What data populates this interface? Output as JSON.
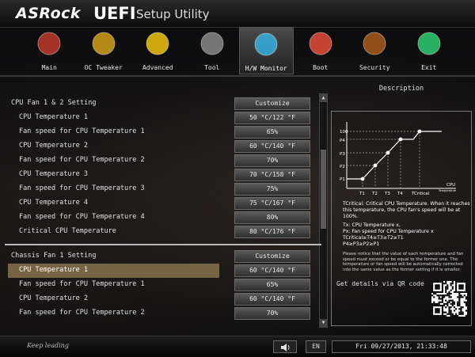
{
  "header": {
    "brand": "ASRock",
    "uefi": "UEFI",
    "subtitle": "Setup Utility"
  },
  "nav": [
    {
      "label": "Main",
      "icon": "main-icon"
    },
    {
      "label": "OC Tweaker",
      "icon": "rocket-icon"
    },
    {
      "label": "Advanced",
      "icon": "star-icon"
    },
    {
      "label": "Tool",
      "icon": "toolbox-icon"
    },
    {
      "label": "H/W Monitor",
      "icon": "radar-icon",
      "active": true
    },
    {
      "label": "Boot",
      "icon": "joystick-icon"
    },
    {
      "label": "Security",
      "icon": "shield-icon"
    },
    {
      "label": "Exit",
      "icon": "exit-icon"
    }
  ],
  "rows": [
    {
      "label": "CPU Fan 1 & 2 Setting",
      "value": "Customize",
      "section": true
    },
    {
      "label": "CPU Temperature 1",
      "value": "50 °C/122 °F"
    },
    {
      "label": "Fan speed for CPU Temperature 1",
      "value": "65%"
    },
    {
      "label": "CPU Temperature 2",
      "value": "60 °C/140 °F"
    },
    {
      "label": "Fan speed for CPU Temperature 2",
      "value": "70%"
    },
    {
      "label": "CPU Temperature 3",
      "value": "70 °C/158 °F"
    },
    {
      "label": "Fan speed for CPU Temperature 3",
      "value": "75%"
    },
    {
      "label": "CPU Temperature 4",
      "value": "75 °C/167 °F"
    },
    {
      "label": "Fan speed for CPU Temperature 4",
      "value": "80%"
    },
    {
      "label": "Critical CPU Temperature",
      "value": "80 °C/176 °F"
    },
    {
      "label": "Chassis Fan 1 Setting",
      "value": "Customize",
      "section": true
    },
    {
      "label": "CPU Temperature 1",
      "value": "60 °C/140 °F",
      "selected": true
    },
    {
      "label": "Fan speed for CPU Temperature 1",
      "value": "65%"
    },
    {
      "label": "CPU Temperature 2",
      "value": "60 °C/140 °F"
    },
    {
      "label": "Fan speed for CPU Temperature 2",
      "value": "70%"
    }
  ],
  "description": {
    "title": "Description",
    "graph_y": [
      "100",
      "P4",
      "P3",
      "P2",
      "P1"
    ],
    "graph_x": [
      "T1",
      "T2",
      "T3",
      "T4",
      "TCritical",
      "CPU"
    ],
    "graph_x_sub": "Temperature",
    "p1": "TCritical: Critical CPU Temperature. When it reaches this temperature, the CPU fan's speed will be at 100%.",
    "p2": "Tx: CPU Temperature x,",
    "p3": "Px: Fan speed for CPU Temperature x",
    "p4": "TCritical≥T4≥T3≥T2≥T1",
    "p5": "P4≥P3≥P2≥P1",
    "p6": "Please notice that the value of each temperature and fan speed must exceed or be equal to the former one. The temperature or fan speed will be automatically corrected into the same value as the former setting if it is smaller.",
    "qr_text": "Get details via QR code"
  },
  "footer": {
    "tagline": "Keep leading",
    "lang": "EN",
    "datetime": "Fri 09/27/2013, 21:33:48"
  },
  "colors": {
    "highlight": "#776445",
    "accent": "#f0c000"
  }
}
